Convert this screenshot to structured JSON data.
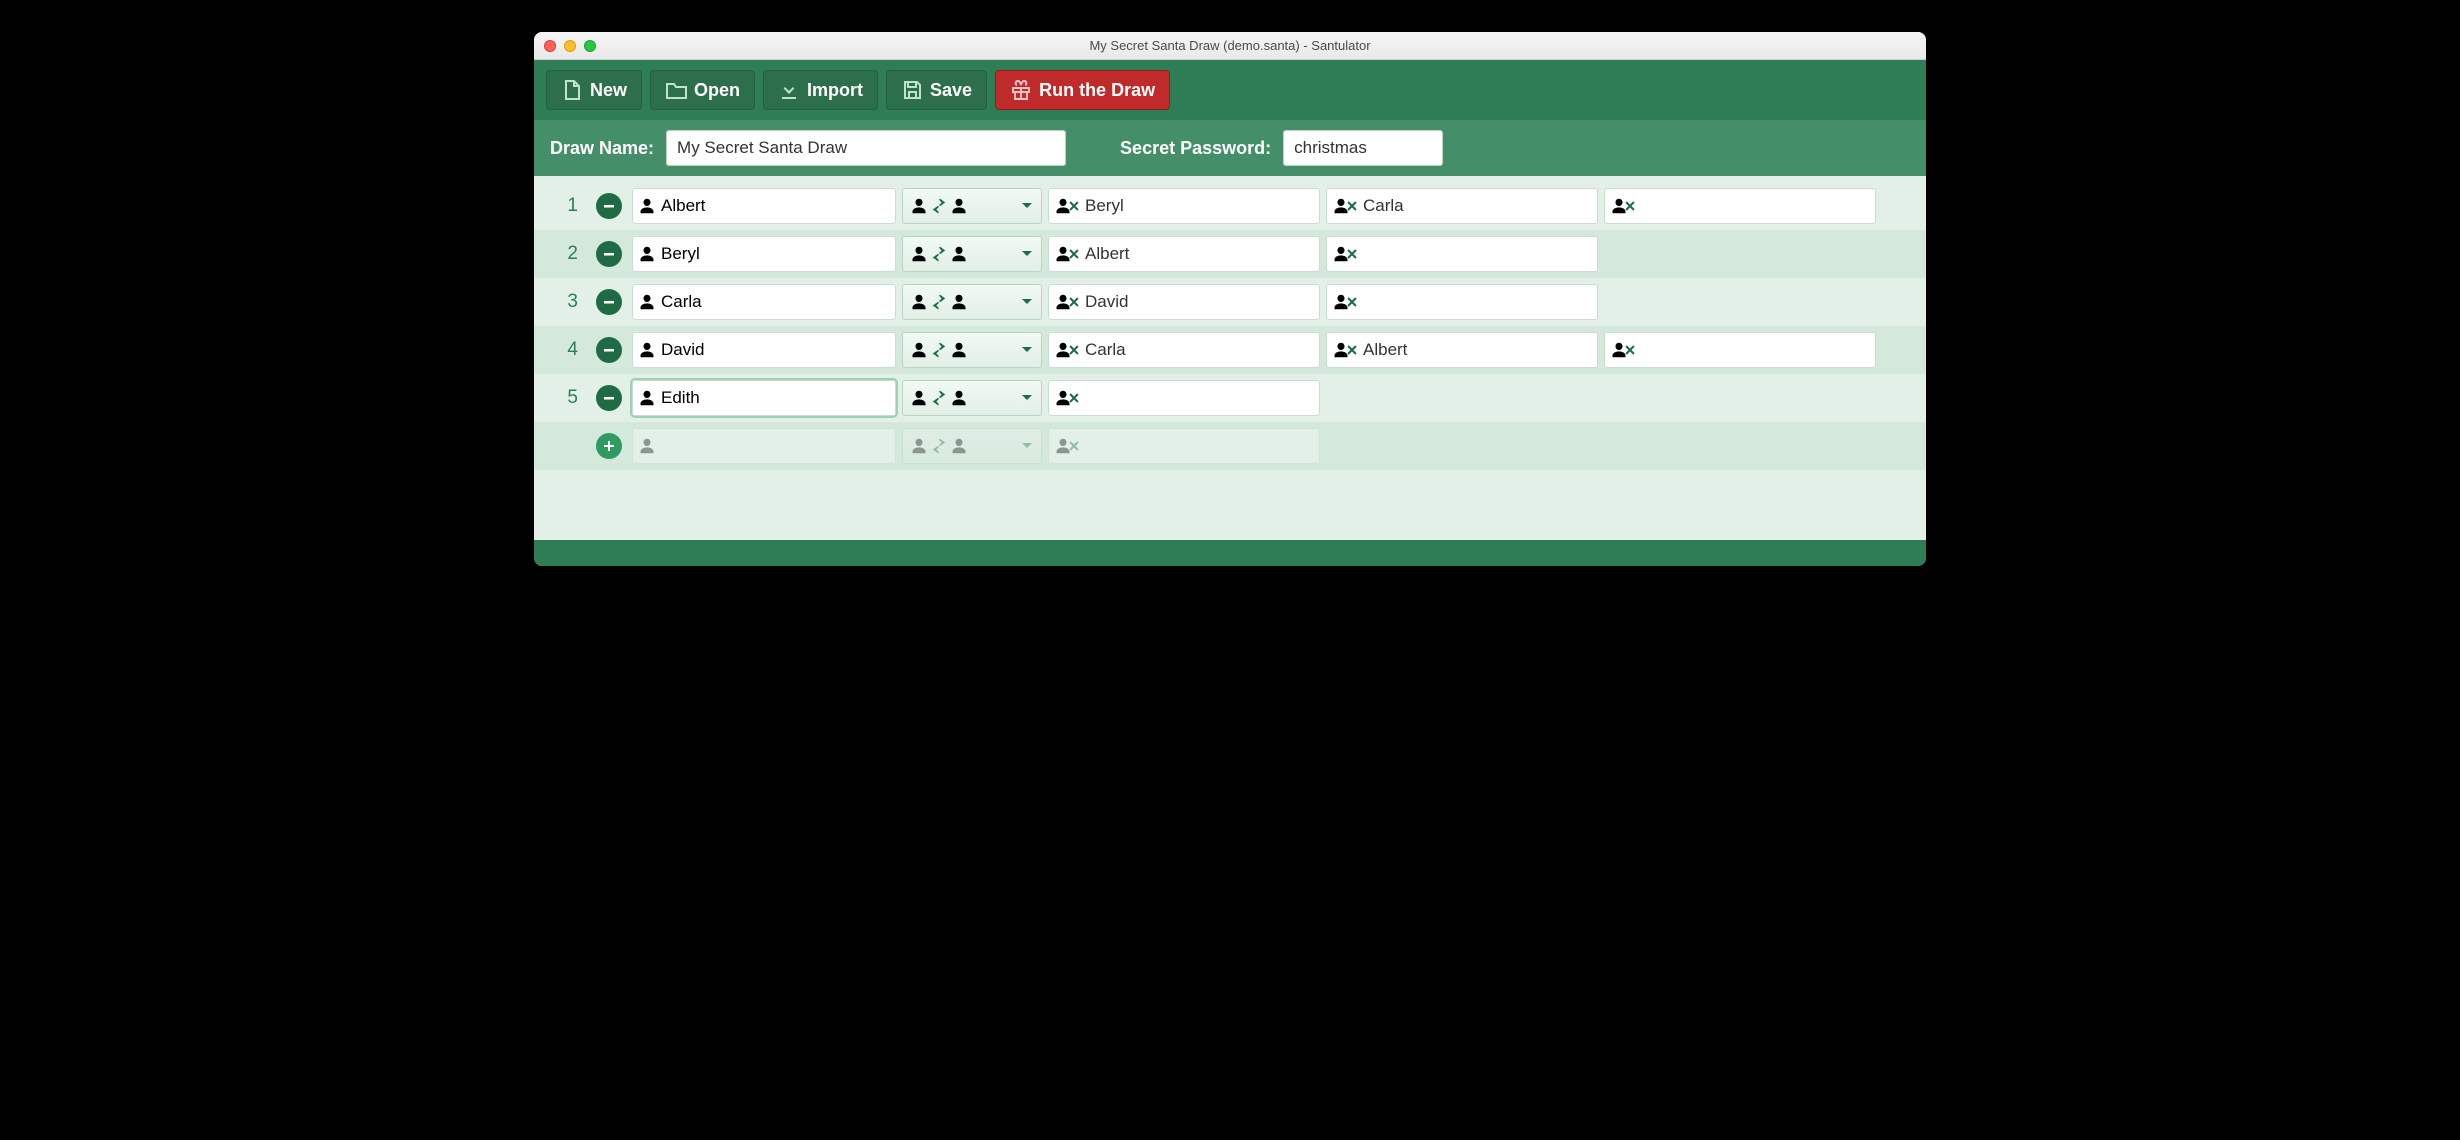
{
  "window": {
    "title": "My Secret Santa Draw (demo.santa) - Santulator"
  },
  "toolbar": {
    "new_label": "New",
    "open_label": "Open",
    "import_label": "Import",
    "save_label": "Save",
    "run_label": "Run the Draw"
  },
  "form": {
    "draw_name_label": "Draw Name:",
    "draw_name_value": "My Secret Santa Draw",
    "password_label": "Secret Password:",
    "password_value": "christmas"
  },
  "rows": [
    {
      "num": "1",
      "name": "Albert",
      "exclusions": [
        "Beryl",
        "Carla",
        ""
      ]
    },
    {
      "num": "2",
      "name": "Beryl",
      "exclusions": [
        "Albert",
        ""
      ]
    },
    {
      "num": "3",
      "name": "Carla",
      "exclusions": [
        "David",
        ""
      ]
    },
    {
      "num": "4",
      "name": "David",
      "exclusions": [
        "Carla",
        "Albert",
        ""
      ]
    },
    {
      "num": "5",
      "name": "Edith",
      "exclusions": [
        ""
      ],
      "active": true
    }
  ],
  "colors": {
    "brand_green": "#2f7d57",
    "accent_red": "#c02a2b"
  }
}
